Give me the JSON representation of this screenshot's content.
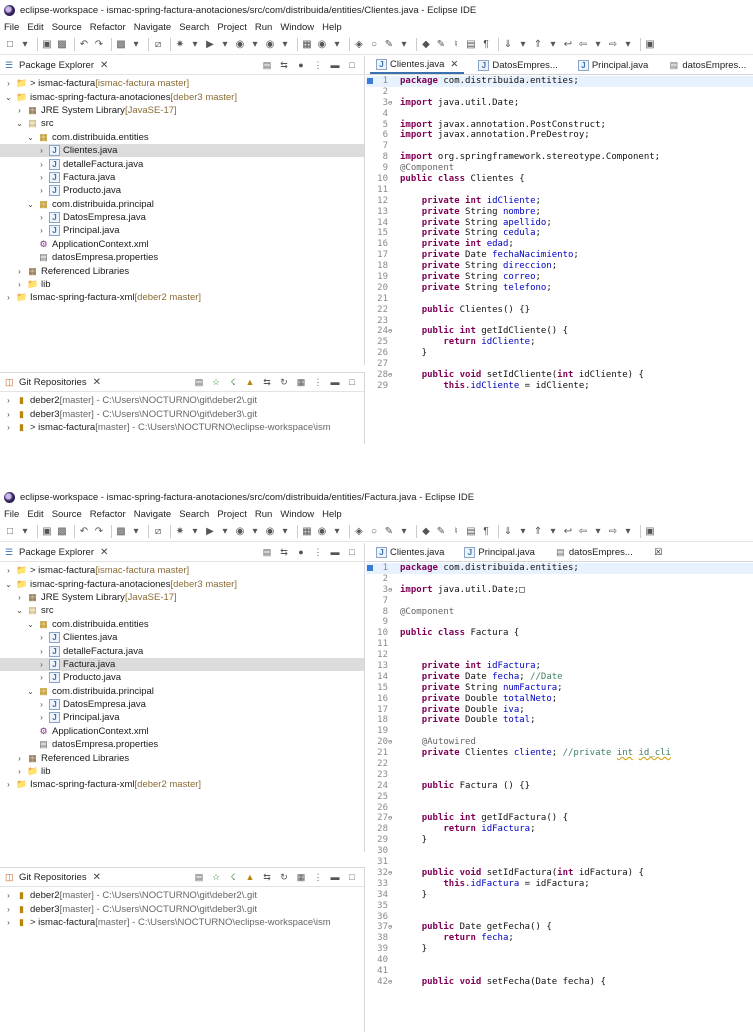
{
  "window1": {
    "title": "eclipse-workspace - ismac-spring-factura-anotaciones/src/com/distribuida/entities/Clientes.java - Eclipse IDE",
    "menu": [
      "File",
      "Edit",
      "Source",
      "Refactor",
      "Navigate",
      "Search",
      "Project",
      "Run",
      "Window",
      "Help"
    ],
    "package_explorer": {
      "title": "Package Explorer",
      "tree": [
        {
          "indent": 0,
          "twisty": ">",
          "icon": "project",
          "label": "> ismac-factura",
          "deco": " [ismac-factura master]"
        },
        {
          "indent": 0,
          "twisty": "v",
          "icon": "project",
          "label": "ismac-spring-factura-anotaciones",
          "deco": " [deber3 master]"
        },
        {
          "indent": 1,
          "twisty": ">",
          "icon": "library",
          "label": "JRE System Library",
          "deco": " [JavaSE-17]"
        },
        {
          "indent": 1,
          "twisty": "v",
          "icon": "src",
          "label": "src",
          "deco": ""
        },
        {
          "indent": 2,
          "twisty": "v",
          "icon": "package",
          "label": "com.distribuida.entities",
          "deco": ""
        },
        {
          "indent": 3,
          "twisty": ">",
          "icon": "java",
          "label": "Clientes.java",
          "deco": "",
          "selected": true
        },
        {
          "indent": 3,
          "twisty": ">",
          "icon": "java",
          "label": "detalleFactura.java",
          "deco": ""
        },
        {
          "indent": 3,
          "twisty": ">",
          "icon": "java",
          "label": "Factura.java",
          "deco": ""
        },
        {
          "indent": 3,
          "twisty": ">",
          "icon": "java",
          "label": "Producto.java",
          "deco": ""
        },
        {
          "indent": 2,
          "twisty": "v",
          "icon": "package",
          "label": "com.distribuida.principal",
          "deco": ""
        },
        {
          "indent": 3,
          "twisty": ">",
          "icon": "java",
          "label": "DatosEmpresa.java",
          "deco": ""
        },
        {
          "indent": 3,
          "twisty": ">",
          "icon": "java",
          "label": "Principal.java",
          "deco": ""
        },
        {
          "indent": 2,
          "twisty": "",
          "icon": "xml",
          "label": "ApplicationContext.xml",
          "deco": ""
        },
        {
          "indent": 2,
          "twisty": "",
          "icon": "properties",
          "label": "datosEmpresa.properties",
          "deco": ""
        },
        {
          "indent": 1,
          "twisty": ">",
          "icon": "library",
          "label": "Referenced Libraries",
          "deco": ""
        },
        {
          "indent": 1,
          "twisty": ">",
          "icon": "folder",
          "label": "lib",
          "deco": ""
        },
        {
          "indent": 0,
          "twisty": ">",
          "icon": "project",
          "label": "Ismac-spring-factura-xml",
          "deco": " [deber2 master]"
        }
      ]
    },
    "git_repositories": {
      "title": "Git Repositories",
      "items": [
        {
          "name": "deber2",
          "rest": " [master] - C:\\Users\\NOCTURNO\\git\\deber2\\.git"
        },
        {
          "name": "deber3",
          "rest": " [master] - C:\\Users\\NOCTURNO\\git\\deber3\\.git"
        },
        {
          "name": "> ismac-factura",
          "rest": " [master] - C:\\Users\\NOCTURNO\\eclipse-workspace\\ism"
        }
      ]
    },
    "tabs": [
      {
        "label": "Clientes.java",
        "icon": "java",
        "active": true,
        "closable": true
      },
      {
        "label": "DatosEmpres...",
        "icon": "java",
        "active": false,
        "closable": false
      },
      {
        "label": "Principal.java",
        "icon": "java",
        "active": false,
        "closable": false
      },
      {
        "label": "datosEmpres...",
        "icon": "properties",
        "active": false,
        "closable": false
      }
    ],
    "code": [
      {
        "n": "1",
        "fold": false,
        "html": "<span class=\"kw\">package</span> com.distribuida.entities;"
      },
      {
        "n": "2",
        "fold": false,
        "html": ""
      },
      {
        "n": "3",
        "fold": true,
        "html": "<span class=\"kw\">import</span> java.util.Date;"
      },
      {
        "n": "4",
        "fold": false,
        "html": ""
      },
      {
        "n": "5",
        "fold": false,
        "html": "<span class=\"kw\">import</span> javax.annotation.PostConstruct;"
      },
      {
        "n": "6",
        "fold": false,
        "html": "<span class=\"kw\">import</span> javax.annotation.PreDestroy;"
      },
      {
        "n": "7",
        "fold": false,
        "html": ""
      },
      {
        "n": "8",
        "fold": false,
        "html": "<span class=\"kw\">import</span> org.springframework.stereotype.Component;"
      },
      {
        "n": "9",
        "fold": false,
        "html": "<span class=\"ann\">@Component</span>"
      },
      {
        "n": "10",
        "fold": false,
        "html": "<span class=\"kw\">public class</span> Clientes {"
      },
      {
        "n": "11",
        "fold": false,
        "html": ""
      },
      {
        "n": "12",
        "fold": false,
        "html": "    <span class=\"kw\">private int</span> <span class=\"fld\">idCliente</span>;"
      },
      {
        "n": "13",
        "fold": false,
        "html": "    <span class=\"kw\">private</span> String <span class=\"fld\">nombre</span>;"
      },
      {
        "n": "14",
        "fold": false,
        "html": "    <span class=\"kw\">private</span> String <span class=\"fld\">apellido</span>;"
      },
      {
        "n": "15",
        "fold": false,
        "html": "    <span class=\"kw\">private</span> String <span class=\"fld\">cedula</span>;"
      },
      {
        "n": "16",
        "fold": false,
        "html": "    <span class=\"kw\">private int</span> <span class=\"fld\">edad</span>;"
      },
      {
        "n": "17",
        "fold": false,
        "html": "    <span class=\"kw\">private</span> Date <span class=\"fld\">fechaNacimiento</span>;"
      },
      {
        "n": "18",
        "fold": false,
        "html": "    <span class=\"kw\">private</span> String <span class=\"fld\">direccion</span>;"
      },
      {
        "n": "19",
        "fold": false,
        "html": "    <span class=\"kw\">private</span> String <span class=\"fld\">correo</span>;"
      },
      {
        "n": "20",
        "fold": false,
        "html": "    <span class=\"kw\">private</span> String <span class=\"fld\">telefono</span>;"
      },
      {
        "n": "21",
        "fold": false,
        "html": ""
      },
      {
        "n": "22",
        "fold": false,
        "html": "    <span class=\"kw\">public</span> Clientes() {}"
      },
      {
        "n": "23",
        "fold": false,
        "html": ""
      },
      {
        "n": "24",
        "fold": true,
        "html": "    <span class=\"kw\">public int</span> getIdCliente() {"
      },
      {
        "n": "25",
        "fold": false,
        "html": "        <span class=\"kw\">return</span> <span class=\"fld\">idCliente</span>;"
      },
      {
        "n": "26",
        "fold": false,
        "html": "    }"
      },
      {
        "n": "27",
        "fold": false,
        "html": ""
      },
      {
        "n": "28",
        "fold": true,
        "html": "    <span class=\"kw\">public void</span> setIdCliente(<span class=\"kw\">int</span> idCliente) {"
      },
      {
        "n": "29",
        "fold": false,
        "html": "        <span class=\"kw\">this</span>.<span class=\"fld\">idCliente</span> = idCliente;"
      }
    ]
  },
  "window2": {
    "title": "eclipse-workspace - ismac-spring-factura-anotaciones/src/com/distribuida/entities/Factura.java - Eclipse IDE",
    "menu": [
      "File",
      "Edit",
      "Source",
      "Refactor",
      "Navigate",
      "Search",
      "Project",
      "Run",
      "Window",
      "Help"
    ],
    "package_explorer": {
      "title": "Package Explorer",
      "tree": [
        {
          "indent": 0,
          "twisty": ">",
          "icon": "project",
          "label": "> ismac-factura",
          "deco": " [ismac-factura master]"
        },
        {
          "indent": 0,
          "twisty": "v",
          "icon": "project",
          "label": "ismac-spring-factura-anotaciones",
          "deco": " [deber3 master]"
        },
        {
          "indent": 1,
          "twisty": ">",
          "icon": "library",
          "label": "JRE System Library",
          "deco": " [JavaSE-17]"
        },
        {
          "indent": 1,
          "twisty": "v",
          "icon": "src",
          "label": "src",
          "deco": ""
        },
        {
          "indent": 2,
          "twisty": "v",
          "icon": "package",
          "label": "com.distribuida.entities",
          "deco": ""
        },
        {
          "indent": 3,
          "twisty": ">",
          "icon": "java",
          "label": "Clientes.java",
          "deco": ""
        },
        {
          "indent": 3,
          "twisty": ">",
          "icon": "java",
          "label": "detalleFactura.java",
          "deco": ""
        },
        {
          "indent": 3,
          "twisty": ">",
          "icon": "java",
          "label": "Factura.java",
          "deco": "",
          "selected": true
        },
        {
          "indent": 3,
          "twisty": ">",
          "icon": "java",
          "label": "Producto.java",
          "deco": ""
        },
        {
          "indent": 2,
          "twisty": "v",
          "icon": "package",
          "label": "com.distribuida.principal",
          "deco": ""
        },
        {
          "indent": 3,
          "twisty": ">",
          "icon": "java",
          "label": "DatosEmpresa.java",
          "deco": ""
        },
        {
          "indent": 3,
          "twisty": ">",
          "icon": "java",
          "label": "Principal.java",
          "deco": ""
        },
        {
          "indent": 2,
          "twisty": "",
          "icon": "xml",
          "label": "ApplicationContext.xml",
          "deco": ""
        },
        {
          "indent": 2,
          "twisty": "",
          "icon": "properties",
          "label": "datosEmpresa.properties",
          "deco": ""
        },
        {
          "indent": 1,
          "twisty": ">",
          "icon": "library",
          "label": "Referenced Libraries",
          "deco": ""
        },
        {
          "indent": 1,
          "twisty": ">",
          "icon": "folder",
          "label": "lib",
          "deco": ""
        },
        {
          "indent": 0,
          "twisty": ">",
          "icon": "project",
          "label": "Ismac-spring-factura-xml",
          "deco": " [deber2 master]"
        }
      ]
    },
    "git_repositories": {
      "title": "Git Repositories",
      "items": [
        {
          "name": "deber2",
          "rest": " [master] - C:\\Users\\NOCTURNO\\git\\deber2\\.git"
        },
        {
          "name": "deber3",
          "rest": " [master] - C:\\Users\\NOCTURNO\\git\\deber3\\.git"
        },
        {
          "name": "> ismac-factura",
          "rest": " [master] - C:\\Users\\NOCTURNO\\eclipse-workspace\\ism"
        }
      ]
    },
    "tabs": [
      {
        "label": "Clientes.java",
        "icon": "java",
        "active": false,
        "closable": false
      },
      {
        "label": "Principal.java",
        "icon": "java",
        "active": false,
        "closable": false
      },
      {
        "label": "datosEmpres...",
        "icon": "properties",
        "active": false,
        "closable": false
      },
      {
        "label": "",
        "icon": "close-box",
        "active": false,
        "closable": false
      }
    ],
    "code": [
      {
        "n": "1",
        "fold": false,
        "html": "<span class=\"kw\">package</span> com.distribuida.entities;"
      },
      {
        "n": "2",
        "fold": false,
        "html": ""
      },
      {
        "n": "3",
        "fold": true,
        "html": "<span class=\"kw\">import</span> java.util.Date;&#9633;"
      },
      {
        "n": "7",
        "fold": false,
        "html": ""
      },
      {
        "n": "8",
        "fold": false,
        "html": "<span class=\"ann\">@Component</span>"
      },
      {
        "n": "9",
        "fold": false,
        "html": ""
      },
      {
        "n": "10",
        "fold": false,
        "html": "<span class=\"kw\">public class</span> Factura {"
      },
      {
        "n": "11",
        "fold": false,
        "html": ""
      },
      {
        "n": "12",
        "fold": false,
        "html": ""
      },
      {
        "n": "13",
        "fold": false,
        "html": "    <span class=\"kw\">private int</span> <span class=\"fld\">idFactura</span>;"
      },
      {
        "n": "14",
        "fold": false,
        "html": "    <span class=\"kw\">private</span> Date <span class=\"fld\">fecha</span>; <span class=\"cmt\">//Date</span>"
      },
      {
        "n": "15",
        "fold": false,
        "html": "    <span class=\"kw\">private</span> String <span class=\"fld\">numFactura</span>;"
      },
      {
        "n": "16",
        "fold": false,
        "html": "    <span class=\"kw\">private</span> Double <span class=\"fld\">totalNeto</span>;"
      },
      {
        "n": "17",
        "fold": false,
        "html": "    <span class=\"kw\">private</span> Double <span class=\"fld\">iva</span>;"
      },
      {
        "n": "18",
        "fold": false,
        "html": "    <span class=\"kw\">private</span> Double <span class=\"fld\">total</span>;"
      },
      {
        "n": "19",
        "fold": false,
        "html": ""
      },
      {
        "n": "20",
        "fold": true,
        "html": "    <span class=\"ann\">@Autowired</span>"
      },
      {
        "n": "21",
        "fold": false,
        "html": "    <span class=\"kw\">private</span> Clientes <span class=\"fld\">cliente</span>; <span class=\"cmt\">//private <span class=\"ul\">int</span> <span class=\"ul\">id_cli</span></span>"
      },
      {
        "n": "22",
        "fold": false,
        "html": ""
      },
      {
        "n": "23",
        "fold": false,
        "html": ""
      },
      {
        "n": "24",
        "fold": false,
        "html": "    <span class=\"kw\">public</span> Factura () {}"
      },
      {
        "n": "25",
        "fold": false,
        "html": ""
      },
      {
        "n": "26",
        "fold": false,
        "html": ""
      },
      {
        "n": "27",
        "fold": true,
        "html": "    <span class=\"kw\">public int</span> getIdFactura() {"
      },
      {
        "n": "28",
        "fold": false,
        "html": "        <span class=\"kw\">return</span> <span class=\"fld\">idFactura</span>;"
      },
      {
        "n": "29",
        "fold": false,
        "html": "    }"
      },
      {
        "n": "30",
        "fold": false,
        "html": ""
      },
      {
        "n": "31",
        "fold": false,
        "html": ""
      },
      {
        "n": "32",
        "fold": true,
        "html": "    <span class=\"kw\">public void</span> setIdFactura(<span class=\"kw\">int</span> idFactura) {"
      },
      {
        "n": "33",
        "fold": false,
        "html": "        <span class=\"kw\">this</span>.<span class=\"fld\">idFactura</span> = idFactura;"
      },
      {
        "n": "34",
        "fold": false,
        "html": "    }"
      },
      {
        "n": "35",
        "fold": false,
        "html": ""
      },
      {
        "n": "36",
        "fold": false,
        "html": ""
      },
      {
        "n": "37",
        "fold": true,
        "html": "    <span class=\"kw\">public</span> Date getFecha() {"
      },
      {
        "n": "38",
        "fold": false,
        "html": "        <span class=\"kw\">return</span> <span class=\"fld\">fecha</span>;"
      },
      {
        "n": "39",
        "fold": false,
        "html": "    }"
      },
      {
        "n": "40",
        "fold": false,
        "html": ""
      },
      {
        "n": "41",
        "fold": false,
        "html": ""
      },
      {
        "n": "42",
        "fold": true,
        "html": "    <span class=\"kw\">public void</span> setFecha(Date fecha) {"
      }
    ]
  }
}
